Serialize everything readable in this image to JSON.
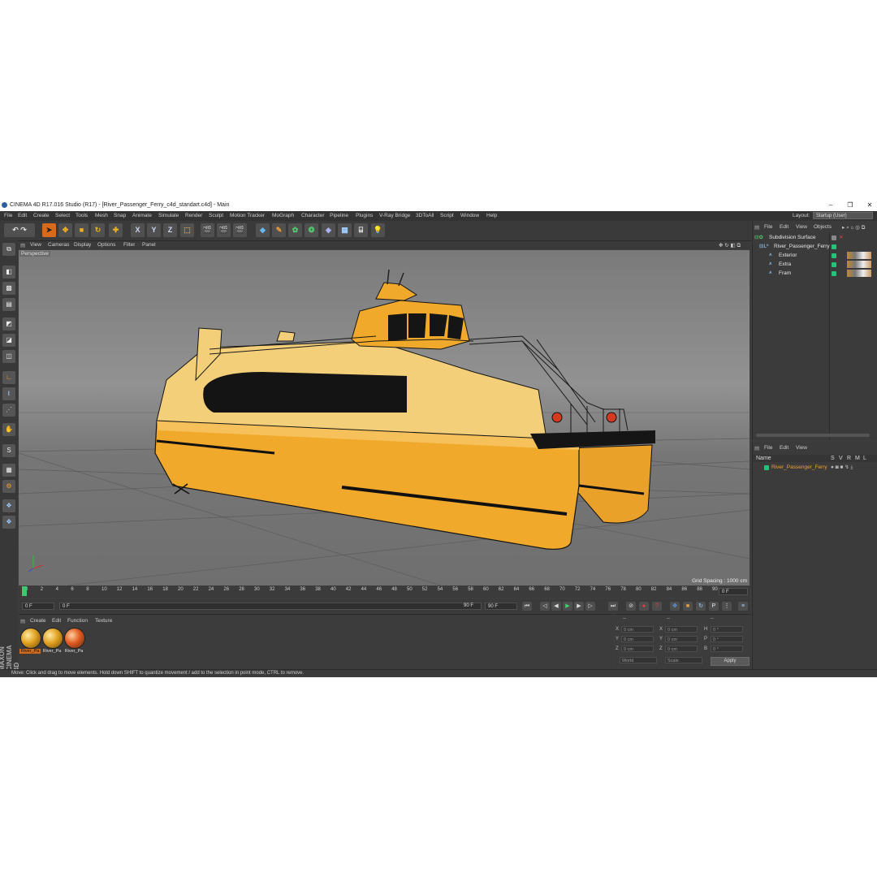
{
  "window": {
    "title": "CINEMA 4D R17.016 Studio (R17) - [River_Passenger_Ferry_c4d_standart.c4d] - Main",
    "controls": [
      "–",
      "❐",
      "✕"
    ]
  },
  "menu": [
    "File",
    "Edit",
    "Create",
    "Select",
    "Tools",
    "Mesh",
    "Snap",
    "Animate",
    "Simulate",
    "Render",
    "Sculpt",
    "Motion Tracker",
    "MoGraph",
    "Character",
    "Pipeline",
    "Plugins",
    "V-Ray Bridge",
    "3DToAll",
    "Script",
    "Window",
    "Help"
  ],
  "layout": {
    "label": "Layout:",
    "value": "Startup (User)"
  },
  "toolbar": {
    "axis_x": "X",
    "axis_y": "Y",
    "axis_z": "Z"
  },
  "viewport": {
    "menu": [
      "View",
      "Cameras",
      "Display",
      "Options",
      "Filter",
      "Panel"
    ],
    "label": "Perspective",
    "grid_spacing": "Grid Spacing : 1000 cm"
  },
  "timeline": {
    "ticks": [
      "0",
      "2",
      "4",
      "6",
      "8",
      "10",
      "12",
      "14",
      "16",
      "18",
      "20",
      "22",
      "24",
      "26",
      "28",
      "30",
      "32",
      "34",
      "36",
      "38",
      "40",
      "42",
      "44",
      "46",
      "48",
      "50",
      "52",
      "54",
      "56",
      "58",
      "60",
      "62",
      "64",
      "66",
      "68",
      "70",
      "72",
      "74",
      "76",
      "78",
      "80",
      "82",
      "84",
      "86",
      "88",
      "90"
    ],
    "end_field": "0 F"
  },
  "transport": {
    "current_frame": "0 F",
    "start_frame": "0 F",
    "range_end": "90 F",
    "end_frame": "90 F"
  },
  "material_manager": {
    "menu": [
      "Create",
      "Edit",
      "Function",
      "Texture"
    ],
    "materials": [
      "River_Pa",
      "River_Pa",
      "River_Pa"
    ]
  },
  "coordinates": {
    "rows": [
      {
        "a": "X",
        "av": "0 cm",
        "b": "X",
        "bv": "0 cm",
        "c": "H",
        "cv": "0 °"
      },
      {
        "a": "Y",
        "av": "0 cm",
        "b": "Y",
        "bv": "0 cm",
        "c": "P",
        "cv": "0 °"
      },
      {
        "a": "Z",
        "av": "0 cm",
        "b": "Z",
        "bv": "0 cm",
        "c": "B",
        "cv": "0 °"
      }
    ],
    "mode": "World",
    "scale": "Scale",
    "apply": "Apply",
    "dash1": "--",
    "dash2": "--",
    "dash3": "--"
  },
  "object_manager": {
    "menu": [
      "File",
      "Edit",
      "View",
      "Objects"
    ],
    "tree": [
      {
        "name": "Subdivision Surface",
        "indent": 0
      },
      {
        "name": "River_Passenger_Ferry",
        "indent": 1
      },
      {
        "name": "Exterior",
        "indent": 2
      },
      {
        "name": "Extra",
        "indent": 2
      },
      {
        "name": "Fram",
        "indent": 2
      }
    ]
  },
  "attribute_manager": {
    "menu": [
      "File",
      "Edit",
      "View"
    ],
    "headers": {
      "name": "Name",
      "s": "S",
      "v": "V",
      "r": "R",
      "m": "M",
      "l": "L"
    },
    "row": "River_Passenger_Ferry"
  },
  "status": "Move: Click and drag to move elements. Hold down SHIFT to quantize movement / add to the selection in point mode, CTRL to remove.",
  "brand": "MAXON CINEMA 4D",
  "colors": {
    "hull_yellow": "#f0a92a",
    "deck_cream": "#f3cf7a",
    "dark": "#151515",
    "panel": "#3d3d3d",
    "active_green": "#29c07a"
  }
}
